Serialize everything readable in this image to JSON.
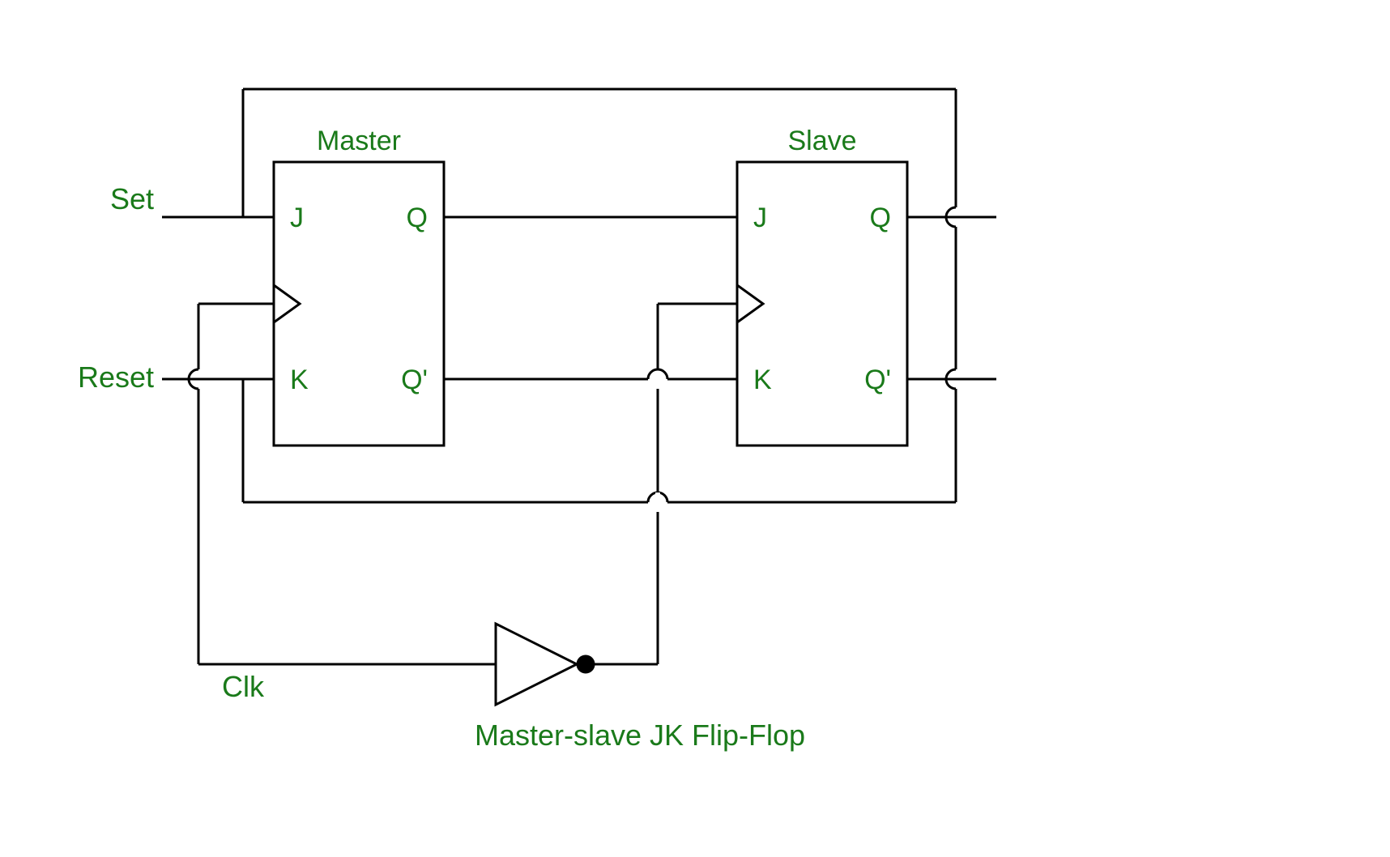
{
  "diagram": {
    "title": "Master-slave JK Flip-Flop",
    "master": {
      "label": "Master",
      "inputs": {
        "j": "J",
        "k": "K"
      },
      "outputs": {
        "q": "Q",
        "qn": "Q'"
      }
    },
    "slave": {
      "label": "Slave",
      "inputs": {
        "j": "J",
        "k": "K"
      },
      "outputs": {
        "q": "Q",
        "qn": "Q'"
      }
    },
    "signals": {
      "set": "Set",
      "reset": "Reset",
      "clk": "Clk"
    },
    "colors": {
      "stroke": "#000000",
      "text": "#1a7a1a",
      "background": "#ffffff"
    }
  }
}
